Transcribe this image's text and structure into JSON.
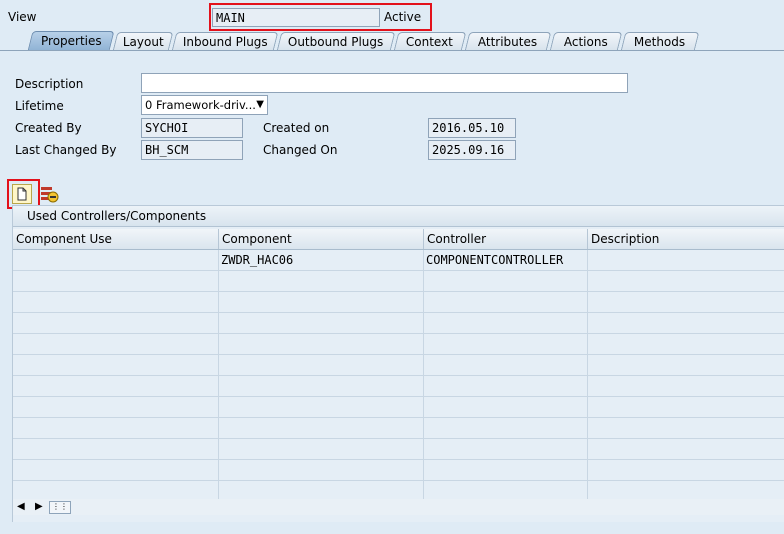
{
  "header": {
    "view_label": "View",
    "view_name": "MAIN",
    "status": "Active"
  },
  "tabs": [
    {
      "label": "Properties",
      "active": true
    },
    {
      "label": "Layout"
    },
    {
      "label": "Inbound Plugs"
    },
    {
      "label": "Outbound Plugs"
    },
    {
      "label": "Context"
    },
    {
      "label": "Attributes"
    },
    {
      "label": "Actions"
    },
    {
      "label": "Methods"
    }
  ],
  "form": {
    "description_label": "Description",
    "description_value": "",
    "lifetime_label": "Lifetime",
    "lifetime_value": "0 Framework-driv...",
    "created_by_label": "Created By",
    "created_by_value": "SYCHOI",
    "created_on_label": "Created on",
    "created_on_value": "2016.05.10",
    "last_changed_by_label": "Last Changed By",
    "last_changed_by_value": "BH_SCM",
    "changed_on_label": "Changed On",
    "changed_on_value": "2025.09.16"
  },
  "table": {
    "title": "Used Controllers/Components",
    "columns": [
      "Component Use",
      "Component",
      "Controller",
      "Description"
    ],
    "rows": [
      [
        "",
        "ZWDR_HAC06",
        "COMPONENTCONTROLLER",
        ""
      ],
      [
        "",
        "",
        "",
        ""
      ],
      [
        "",
        "",
        "",
        ""
      ],
      [
        "",
        "",
        "",
        ""
      ],
      [
        "",
        "",
        "",
        ""
      ],
      [
        "",
        "",
        "",
        ""
      ],
      [
        "",
        "",
        "",
        ""
      ],
      [
        "",
        "",
        "",
        ""
      ],
      [
        "",
        "",
        "",
        ""
      ],
      [
        "",
        "",
        "",
        ""
      ],
      [
        "",
        "",
        "",
        ""
      ],
      [
        "",
        "",
        "",
        ""
      ]
    ]
  },
  "icons": {
    "create": "new-document-icon",
    "delete_row": "delete-row-icon",
    "scroll_left": "arrow-left-icon",
    "scroll_right": "arrow-right-icon",
    "column_settings": "column-settings-icon",
    "dropdown": "dropdown-arrow-icon"
  },
  "colors": {
    "highlight": "#e3111b",
    "background": "#dfebf5",
    "active_tab": "#8fb2d4"
  }
}
